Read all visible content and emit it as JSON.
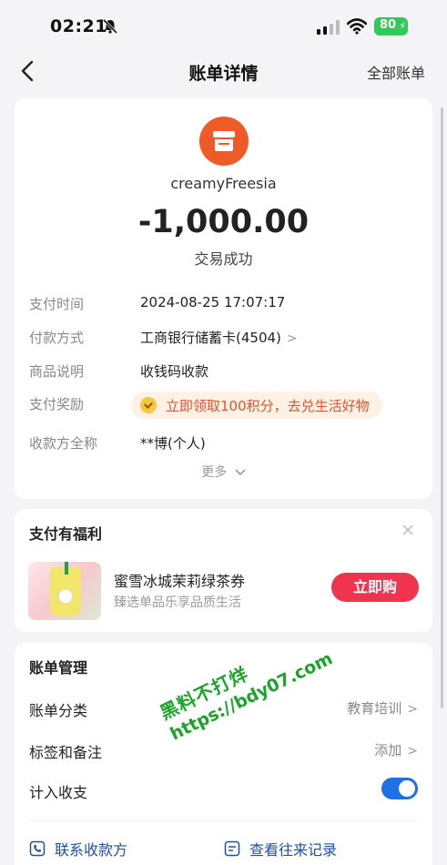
{
  "status_bar": {
    "time": "02:21",
    "battery": "80",
    "battery_color": "#34c759"
  },
  "nav": {
    "title": "账单详情",
    "right_link": "全部账单"
  },
  "summary": {
    "merchant_name": "creamyFreesia",
    "amount": "-1,000.00",
    "status": "交易成功",
    "logo_color": "#f05a28",
    "rows": [
      {
        "label": "支付时间",
        "value": "2024-08-25 17:07:17"
      },
      {
        "label": "付款方式",
        "value": "工商银行储蓄卡(4504)"
      },
      {
        "label": "商品说明",
        "value": "收钱码收款"
      },
      {
        "label": "支付奖励",
        "value": "立即领取100积分，去兑生活好物"
      },
      {
        "label": "收款方全称",
        "value": "**博(个人)"
      }
    ],
    "more": "更多"
  },
  "benefits": {
    "title": "支付有福利",
    "product_name": "蜜雪冰城茉莉绿茶券",
    "product_desc": "臻选单品乐享品质生活",
    "buy_label": "立即购",
    "buy_color": "#f0344f"
  },
  "management": {
    "title": "账单管理",
    "category_label": "账单分类",
    "category_value": "教育培训",
    "tags_label": "标签和备注",
    "tags_value": "添加",
    "include_label": "计入收支",
    "include_enabled": true,
    "contact_label": "联系收款方",
    "history_label": "查看往来记录",
    "accent_color": "#1f6fe5"
  },
  "watermark": {
    "line1": "黑料不打烊",
    "line2": "https://bdy07.com"
  }
}
